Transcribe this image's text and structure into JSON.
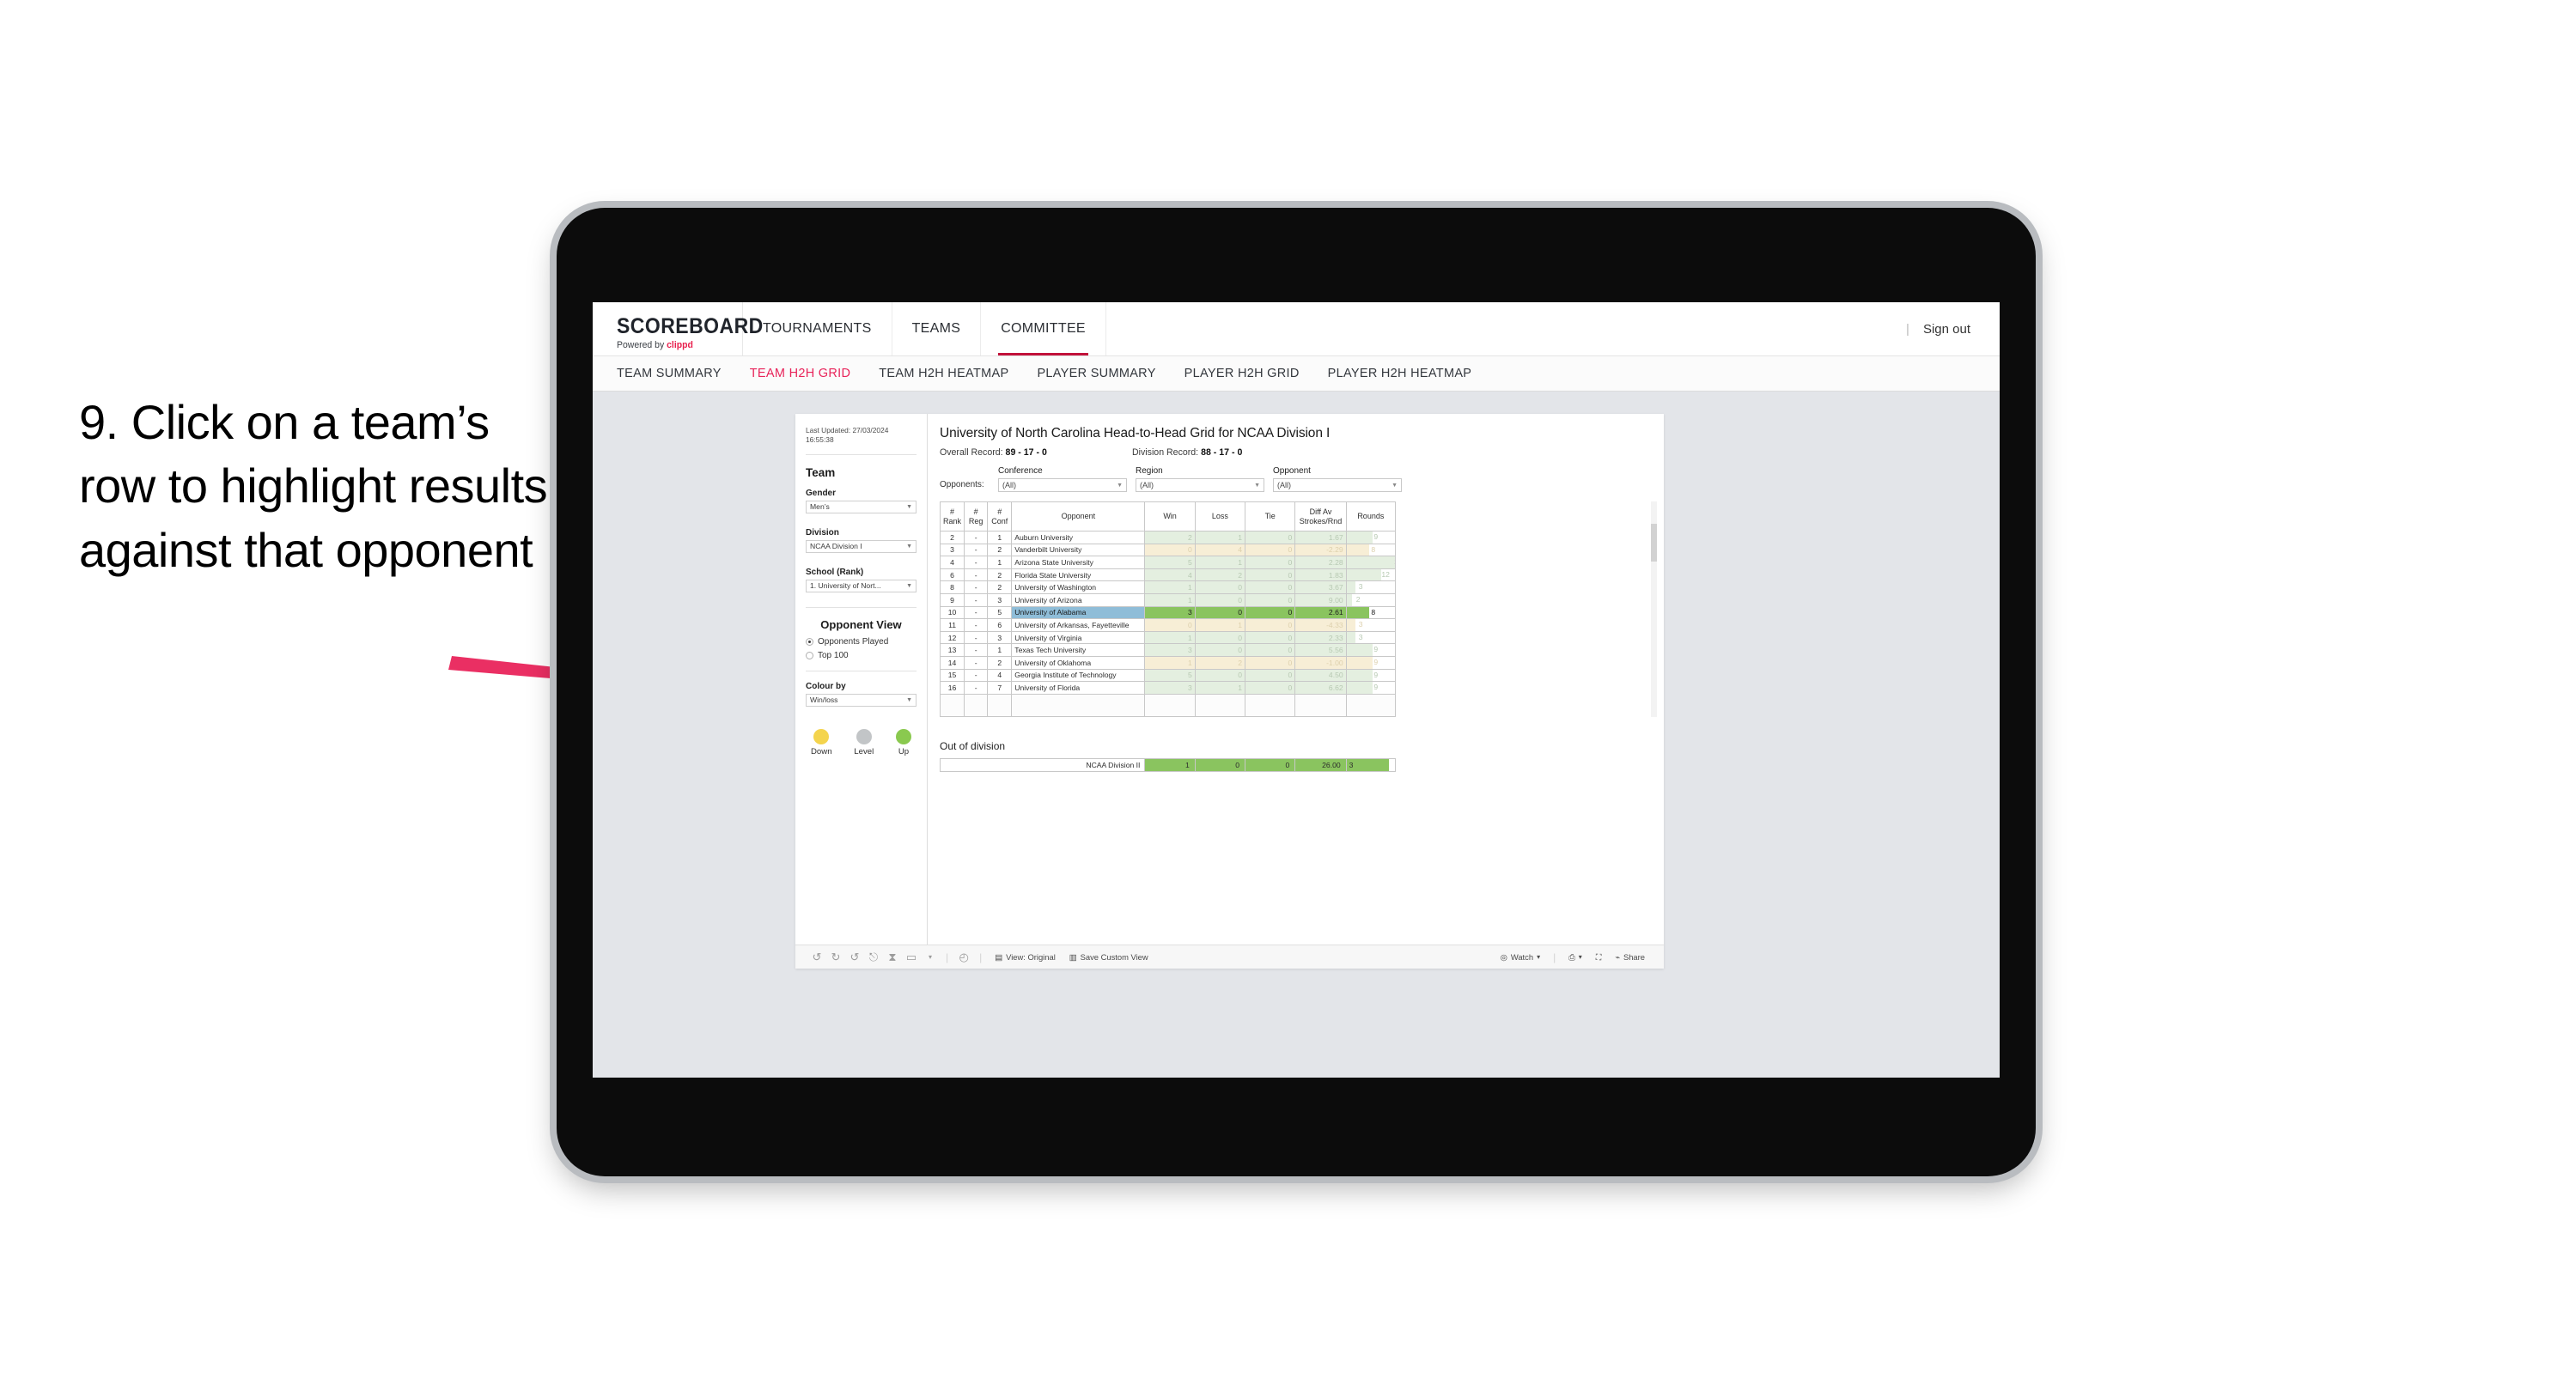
{
  "instruction": {
    "text": "9. Click on a team’s row to highlight results against that opponent"
  },
  "colors": {
    "accent_pink": "#e8245a",
    "arrow": "#ea2f63",
    "win_green": "#8ac45f",
    "selected_blue": "#8fbdd8",
    "down_yellow": "#f4d44d",
    "level_grey": "#c2c5c7",
    "up_green": "#8ac94f"
  },
  "app": {
    "brand": {
      "title": "SCOREBOARD",
      "powered_prefix": "Powered by ",
      "powered_name": "clippd"
    },
    "topnav": [
      {
        "label": "TOURNAMENTS",
        "active": false
      },
      {
        "label": "TEAMS",
        "active": false
      },
      {
        "label": "COMMITTEE",
        "active": true
      }
    ],
    "topbar_right": {
      "divider": "|",
      "sign_out": "Sign out"
    },
    "subnav": [
      {
        "label": "TEAM SUMMARY",
        "active": false
      },
      {
        "label": "TEAM H2H GRID",
        "active": true
      },
      {
        "label": "TEAM H2H HEATMAP",
        "active": false
      },
      {
        "label": "PLAYER SUMMARY",
        "active": false
      },
      {
        "label": "PLAYER H2H GRID",
        "active": false
      },
      {
        "label": "PLAYER H2H HEATMAP",
        "active": false
      }
    ]
  },
  "sidebar": {
    "last_updated": "Last Updated: 27/03/2024 16:55:38",
    "team_heading": "Team",
    "filters": [
      {
        "label": "Gender",
        "value": "Men’s"
      },
      {
        "label": "Division",
        "value": "NCAA Division I"
      },
      {
        "label": "School (Rank)",
        "value": "1. University of Nort..."
      }
    ],
    "opponent_view": {
      "heading": "Opponent View",
      "options": [
        {
          "label": "Opponents Played",
          "selected": true
        },
        {
          "label": "Top 100",
          "selected": false
        }
      ]
    },
    "colour_by": {
      "label": "Colour by",
      "value": "Win/loss"
    },
    "legend": [
      {
        "label": "Down",
        "color": "#f4d44d"
      },
      {
        "label": "Level",
        "color": "#c2c5c7"
      },
      {
        "label": "Up",
        "color": "#8ac94f"
      }
    ]
  },
  "main": {
    "title": "University of North Carolina Head-to-Head Grid for NCAA Division I",
    "overall_record_label": "Overall Record: ",
    "overall_record_value": "89 - 17 - 0",
    "division_record_label": "Division Record: ",
    "division_record_value": "88 - 17 - 0",
    "opponents_label": "Opponents:",
    "opponent_filters": [
      {
        "label": "Conference",
        "value": "(All)"
      },
      {
        "label": "Region",
        "value": "(All)"
      },
      {
        "label": "Opponent",
        "value": "(All)"
      }
    ],
    "table_headers": {
      "rank": "# Rank",
      "reg": "# Reg",
      "conf": "# Conf",
      "opponent": "Opponent",
      "win": "Win",
      "loss": "Loss",
      "tie": "Tie",
      "diff": "Diff Av Strokes/Rnd",
      "rounds": "Rounds"
    },
    "rows": [
      {
        "rank": "2",
        "reg": "-",
        "conf": "1",
        "opponent": "Auburn University",
        "win": "2",
        "loss": "1",
        "tie": "0",
        "diff": "1.67",
        "rounds": "9",
        "state": "win",
        "bar_pct": 53
      },
      {
        "rank": "3",
        "reg": "-",
        "conf": "2",
        "opponent": "Vanderbilt University",
        "win": "0",
        "loss": "4",
        "tie": "0",
        "diff": "-2.29",
        "rounds": "8",
        "state": "loss",
        "bar_pct": 47
      },
      {
        "rank": "4",
        "reg": "-",
        "conf": "1",
        "opponent": "Arizona State University",
        "win": "5",
        "loss": "1",
        "tie": "0",
        "diff": "2.28",
        "rounds": "17",
        "state": "win",
        "bar_pct": 100
      },
      {
        "rank": "6",
        "reg": "-",
        "conf": "2",
        "opponent": "Florida State University",
        "win": "4",
        "loss": "2",
        "tie": "0",
        "diff": "1.83",
        "rounds": "12",
        "state": "win",
        "bar_pct": 71
      },
      {
        "rank": "8",
        "reg": "-",
        "conf": "2",
        "opponent": "University of Washington",
        "win": "1",
        "loss": "0",
        "tie": "0",
        "diff": "3.67",
        "rounds": "3",
        "state": "win",
        "bar_pct": 18
      },
      {
        "rank": "9",
        "reg": "-",
        "conf": "3",
        "opponent": "University of Arizona",
        "win": "1",
        "loss": "0",
        "tie": "0",
        "diff": "9.00",
        "rounds": "2",
        "state": "win",
        "bar_pct": 12
      },
      {
        "rank": "10",
        "reg": "-",
        "conf": "5",
        "opponent": "University of Alabama",
        "win": "3",
        "loss": "0",
        "tie": "0",
        "diff": "2.61",
        "rounds": "8",
        "state": "sel",
        "bar_pct": 47
      },
      {
        "rank": "11",
        "reg": "-",
        "conf": "6",
        "opponent": "University of Arkansas, Fayetteville",
        "win": "0",
        "loss": "1",
        "tie": "0",
        "diff": "-4.33",
        "rounds": "3",
        "state": "loss",
        "bar_pct": 18
      },
      {
        "rank": "12",
        "reg": "-",
        "conf": "3",
        "opponent": "University of Virginia",
        "win": "1",
        "loss": "0",
        "tie": "0",
        "diff": "2.33",
        "rounds": "3",
        "state": "win",
        "bar_pct": 18
      },
      {
        "rank": "13",
        "reg": "-",
        "conf": "1",
        "opponent": "Texas Tech University",
        "win": "3",
        "loss": "0",
        "tie": "0",
        "diff": "5.56",
        "rounds": "9",
        "state": "win",
        "bar_pct": 53
      },
      {
        "rank": "14",
        "reg": "-",
        "conf": "2",
        "opponent": "University of Oklahoma",
        "win": "1",
        "loss": "2",
        "tie": "0",
        "diff": "-1.00",
        "rounds": "9",
        "state": "loss",
        "bar_pct": 53
      },
      {
        "rank": "15",
        "reg": "-",
        "conf": "4",
        "opponent": "Georgia Institute of Technology",
        "win": "5",
        "loss": "0",
        "tie": "0",
        "diff": "4.50",
        "rounds": "9",
        "state": "win",
        "bar_pct": 53
      },
      {
        "rank": "16",
        "reg": "-",
        "conf": "7",
        "opponent": "University of Florida",
        "win": "3",
        "loss": "1",
        "tie": "0",
        "diff": "6.62",
        "rounds": "9",
        "state": "win",
        "bar_pct": 53
      }
    ],
    "out_of_division": {
      "title": "Out of division",
      "row": {
        "label": "NCAA Division II",
        "win": "1",
        "loss": "0",
        "tie": "0",
        "diff": "26.00",
        "rounds": "3",
        "bar_pct": 88
      }
    }
  },
  "footer": {
    "icons": [
      {
        "name": "undo-icon",
        "glyph": "↺"
      },
      {
        "name": "redo-icon",
        "glyph": "↻"
      },
      {
        "name": "revert-icon",
        "glyph": "↺"
      },
      {
        "name": "refresh-data-icon",
        "glyph": "⎋"
      },
      {
        "name": "pause-updates-icon",
        "glyph": "⏸"
      },
      {
        "name": "device-layout-icon",
        "glyph": "▭"
      },
      {
        "name": "device-layout-caret-icon",
        "glyph": "▾"
      },
      {
        "name": "performance-icon",
        "glyph": "⏱"
      }
    ],
    "buttons": [
      {
        "name": "view-original-button",
        "icon": "view-icon",
        "label": "View: Original"
      },
      {
        "name": "save-custom-view-button",
        "icon": "save-view-icon",
        "label": "Save Custom View"
      },
      {
        "name": "watch-button",
        "icon": "watch-icon",
        "label": "Watch",
        "caret": "▾"
      },
      {
        "name": "download-button",
        "icon": "download-icon",
        "label": "",
        "caret": "▾"
      },
      {
        "name": "fullscreen-button",
        "icon": "fullscreen-icon",
        "label": ""
      },
      {
        "name": "share-button",
        "icon": "share-icon",
        "label": "Share"
      }
    ],
    "separator": "|"
  }
}
